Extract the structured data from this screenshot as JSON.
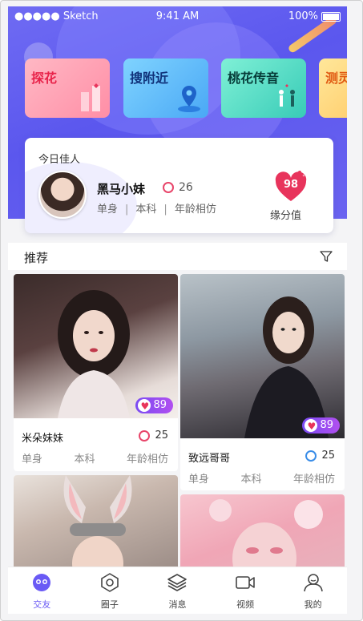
{
  "status_bar": {
    "carrier": "●●●●● Sketch",
    "time": "9:41 AM",
    "battery": "100%"
  },
  "feature_cards": [
    {
      "label": "探花",
      "icon": "explore-icon"
    },
    {
      "label": "搜附近",
      "icon": "location-pin-icon"
    },
    {
      "label": "桃花传音",
      "icon": "couple-icon"
    },
    {
      "label": "测灵",
      "icon": "test-icon"
    }
  ],
  "today_pick": {
    "title": "今日佳人",
    "name": "黑马小妹",
    "age": "26",
    "tags": [
      "单身",
      "本科",
      "年龄相仿"
    ],
    "score": "98",
    "score_label": "缘分值"
  },
  "recommend": {
    "title": "推荐"
  },
  "profiles": [
    {
      "name": "米朵妹妹",
      "age": "25",
      "gender": "female",
      "score": "89",
      "tags": [
        "单身",
        "本科",
        "年龄相仿"
      ]
    },
    {
      "name": "致远哥哥",
      "age": "25",
      "gender": "male",
      "score": "89",
      "tags": [
        "单身",
        "本科",
        "年龄相仿"
      ]
    },
    {
      "name": "",
      "age": "",
      "gender": "female",
      "score": "",
      "tags": []
    },
    {
      "name": "",
      "age": "",
      "gender": "female",
      "score": "",
      "tags": []
    }
  ],
  "tab_bar": [
    {
      "label": "交友",
      "icon": "friends-icon",
      "active": true
    },
    {
      "label": "圈子",
      "icon": "circle-icon",
      "active": false
    },
    {
      "label": "消息",
      "icon": "message-layers-icon",
      "active": false
    },
    {
      "label": "视频",
      "icon": "video-icon",
      "active": false
    },
    {
      "label": "我的",
      "icon": "profile-icon",
      "active": false
    }
  ],
  "colors": {
    "primary": "#5b57ee",
    "accent": "#e8345c",
    "male": "#3a8de8",
    "female": "#e8456a"
  }
}
